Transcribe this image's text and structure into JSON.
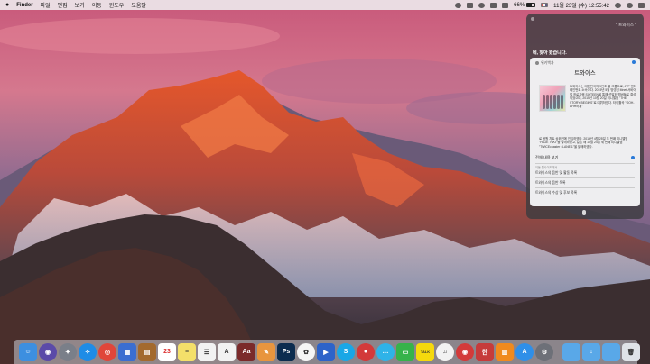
{
  "menubar": {
    "app_name": "Finder",
    "menus": [
      "파일",
      "편집",
      "보기",
      "이동",
      "윈도우",
      "도움말"
    ],
    "battery_percent": "66%",
    "battery_level": 0.66,
    "datetime": "11월 23일 (수) 12:55:42",
    "apple_icon": "apple-icon",
    "status_icons": [
      "wifi-icon",
      "bluetooth-icon",
      "volume-icon",
      "input-flag-icon",
      "search-icon",
      "siri-icon",
      "list-icon"
    ]
  },
  "siri": {
    "query": "\" 트와이스 \"",
    "response": "네, 찾아 봤습니다.",
    "card": {
      "source": "위키백과",
      "title": "트와이스",
      "summary": "트와이스는 대한민국의 9인조 걸 그룹으로, JYP 엔터테인먼트 소속이다. 2015년 5월 방영된 Mnet 서바이벌 프로그램 SIXTEEN을 통해 선발된 멤버들로 결성되었으며, 2015년 10월 20일 미니앨범 \"THE STORY BEGINS\"로 데뷔하였다. 타이틀곡 \"OOH-AHH하게\"",
      "summary_more": "로 음원 차트 상위권에 진입하였다. 2016년 4월 25일 두 번째 미니앨범 \"PAGE TWO\"를 발매하였고, 같은 해 10월 24일 세 번째 미니앨범 \"TWICEcoaster : LANE 1\"을 발매하였다.",
      "more_label": "전체 내용 보기",
      "section_label": "이동 웹사이트에서",
      "links": [
        "트와이스의 음반 및 활동 목록",
        "트와이스의 음반 목록",
        "트와이스의 수상 및 후보 목록"
      ]
    }
  },
  "dock": {
    "apps": [
      {
        "name": "finder-icon",
        "color": "#3d8fe0",
        "glyph": "☺"
      },
      {
        "name": "siri-dock-icon",
        "color": "#5b4aa8",
        "glyph": "◉"
      },
      {
        "name": "launchpad-icon",
        "color": "#7a7f89",
        "glyph": "✦"
      },
      {
        "name": "safari-icon",
        "color": "#1e8ce6",
        "glyph": "✧"
      },
      {
        "name": "chrome-icon",
        "color": "#e0463a",
        "glyph": "◎"
      },
      {
        "name": "photos-viewer-icon",
        "color": "#3b6ed1",
        "glyph": "▦"
      },
      {
        "name": "notes-bookmark-icon",
        "color": "#a36a2e",
        "glyph": "▤"
      },
      {
        "name": "calendar-icon",
        "color": "#ffffff",
        "glyph": "23"
      },
      {
        "name": "notes-icon",
        "color": "#f4e06a",
        "glyph": "≡"
      },
      {
        "name": "reminders-icon",
        "color": "#f2f2f2",
        "glyph": "☰"
      },
      {
        "name": "textedit-icon",
        "color": "#f2f2f2",
        "glyph": "A"
      },
      {
        "name": "dictionary-icon",
        "color": "#7b2a2a",
        "glyph": "Aa"
      },
      {
        "name": "pages-icon",
        "color": "#e8953e",
        "glyph": "✎"
      },
      {
        "name": "photoshop-icon",
        "color": "#0c2c4f",
        "glyph": "Ps"
      },
      {
        "name": "photos-icon",
        "color": "#f5f5f5",
        "glyph": "✿"
      },
      {
        "name": "keynote-icon",
        "color": "#2d63c9",
        "glyph": "▶"
      },
      {
        "name": "skype-icon",
        "color": "#19a7e6",
        "glyph": "S"
      },
      {
        "name": "photo-booth-icon",
        "color": "#d33a3a",
        "glyph": "●"
      },
      {
        "name": "messages-icon",
        "color": "#2fb3e8",
        "glyph": "…"
      },
      {
        "name": "facetime-icon",
        "color": "#36b34a",
        "glyph": "▭"
      },
      {
        "name": "kakaotalk-icon",
        "color": "#f5d90d",
        "glyph": "TALK"
      },
      {
        "name": "music-icon",
        "color": "#f2f2f2",
        "glyph": "♫"
      },
      {
        "name": "netease-music-icon",
        "color": "#d33a3a",
        "glyph": "◉"
      },
      {
        "name": "app-store-korean-icon",
        "color": "#c63b3b",
        "glyph": "한"
      },
      {
        "name": "ibooks-icon",
        "color": "#f08a1e",
        "glyph": "▥"
      },
      {
        "name": "app-store-icon",
        "color": "#2f8fe8",
        "glyph": "A"
      },
      {
        "name": "system-preferences-icon",
        "color": "#6d7078",
        "glyph": "⚙"
      },
      {
        "name": "folder-icon",
        "color": "#59a8e8",
        "glyph": ""
      },
      {
        "name": "downloads-folder-icon",
        "color": "#59a8e8",
        "glyph": "↓"
      },
      {
        "name": "documents-folder-icon",
        "color": "#59a8e8",
        "glyph": ""
      },
      {
        "name": "trash-icon",
        "color": "#dfe3e8",
        "glyph": "🗑"
      }
    ]
  }
}
